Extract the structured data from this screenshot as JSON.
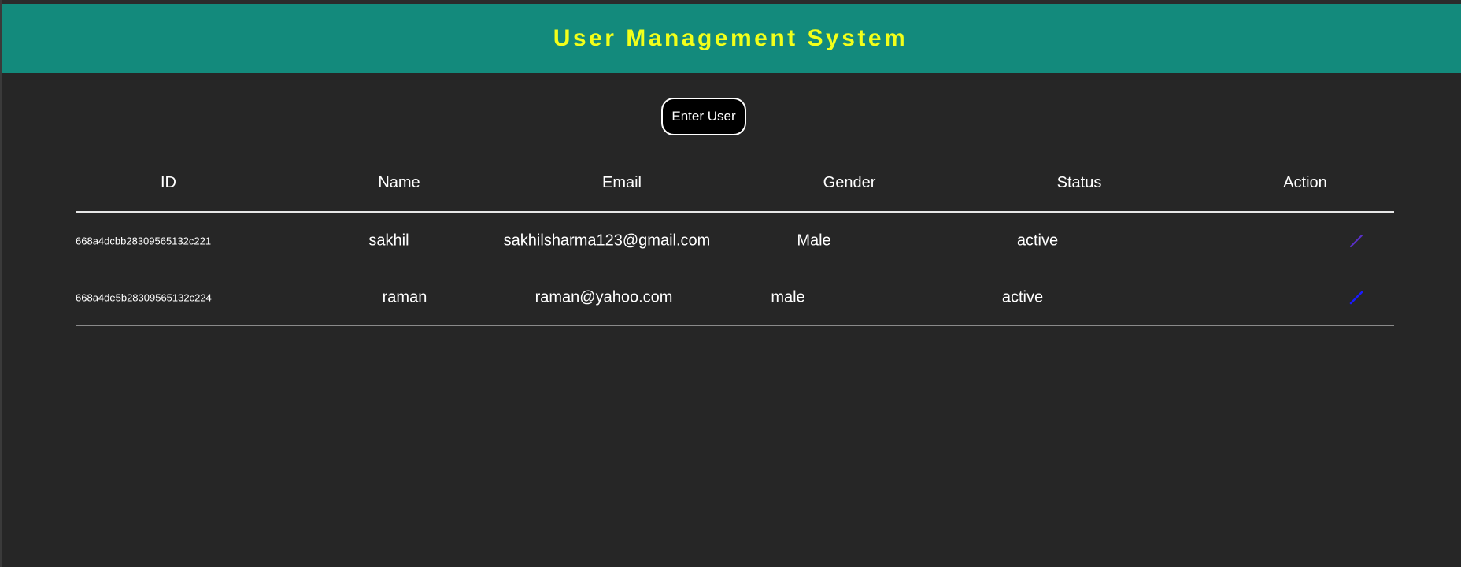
{
  "header": {
    "title": "User Management System",
    "background_color": "#138a7c",
    "title_color": "#f2ff1a"
  },
  "actions": {
    "enter_user_label": "Enter User"
  },
  "table": {
    "columns": [
      "ID",
      "Name",
      "Email",
      "Gender",
      "Status",
      "Action"
    ],
    "rows": [
      {
        "id": "668a4dcbb28309565132c221",
        "name": "sakhil",
        "email": "sakhilsharma123@gmail.com",
        "gender": "Male",
        "status": "active",
        "action_icon": "pencil-edit-icon",
        "action_icon_color": "#5a2fc8"
      },
      {
        "id": "668a4de5b28309565132c224",
        "name": "raman",
        "email": "raman@yahoo.com",
        "gender": "male",
        "status": "active",
        "action_icon": "pencil-edit-icon",
        "action_icon_color": "#1a1aff"
      }
    ]
  }
}
